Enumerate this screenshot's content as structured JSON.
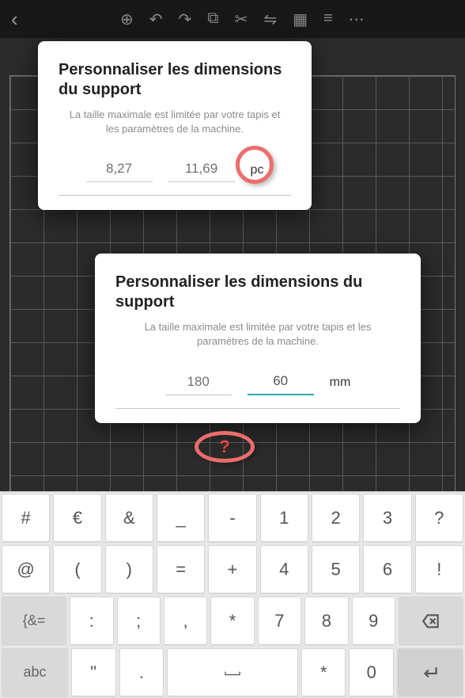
{
  "topbar": {
    "back_glyph": "‹"
  },
  "dialog1": {
    "title": "Personnaliser les dimensions du support",
    "subtitle": "La taille maximale est limitée par votre tapis et les paramètres de la machine.",
    "width": "8,27",
    "height": "11,69",
    "unit": "pc"
  },
  "dialog2": {
    "title": "Personnaliser les dimensions du support",
    "subtitle": "La taille maximale est limitée par votre tapis et les paramètres de la machine.",
    "width": "180",
    "height": "60",
    "unit": "mm"
  },
  "annotation": {
    "question_mark": "?"
  },
  "keyboard": {
    "row1": [
      "#",
      "€",
      "&",
      "_",
      "-",
      "1",
      "2",
      "3",
      "?"
    ],
    "row2": [
      "@",
      "(",
      ")",
      "=",
      "+",
      "4",
      "5",
      "6",
      "!"
    ],
    "row3_prefix": "{&=",
    "row3": [
      ":",
      ";",
      ",",
      "*",
      "7",
      "8",
      "9"
    ],
    "row4_abc": "abc",
    "row4": [
      "\"",
      ".",
      "",
      "*",
      "0"
    ]
  }
}
